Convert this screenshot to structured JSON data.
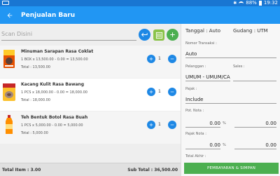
{
  "status_bar": {
    "battery": "88%",
    "time": "19:32"
  },
  "app_bar": {
    "title": "Penjualan Baru"
  },
  "scan": {
    "placeholder": "Scan Disini"
  },
  "items": [
    {
      "name": "Minuman Sarapan Rasa Coklat",
      "detail": "1 BOX x 13,500.00 - 0.00 = 13,500.00",
      "total": "Total : 13,500.00",
      "qty": "1"
    },
    {
      "name": "Kacang Kulit Rasa Bawang",
      "detail": "1 PCS x 18,000.00 - 0.00 = 18,000.00",
      "total": "Total : 18,000.00",
      "qty": "1"
    },
    {
      "name": "Teh Bentuk Botol Rasa Buah",
      "detail": "1 PCS x 5,000.00 - 0.00 = 5,000.00",
      "total": "Total : 5,000.00",
      "qty": "1"
    }
  ],
  "footer": {
    "total_item": "Total Item : 3.00",
    "sub_total": "Sub Total : 36,500.00"
  },
  "right_pane": {
    "tanggal": "Tanggal : Auto",
    "gudang": "Gudang : UTM",
    "nomor_transaksi_label": "Nomor Transaksi :",
    "nomor_transaksi_value": "Auto",
    "pelanggan_label": "Pelanggan :",
    "pelanggan_value": "UMUM - UMUM/CA",
    "sales_label": "Sales :",
    "pajak_label": "Pajak :",
    "pajak_value": "Include",
    "pot_nota_label": "Pot. Nota :",
    "pot_nota_percent": "0.00",
    "pot_nota_amount": "0.00",
    "pajak_nota_label": "Pajak Nota :",
    "pajak_nota_percent": "0.00",
    "pajak_nota_amount": "0.00",
    "percent_sign": "%",
    "total_akhir_label": "Total Akhir :",
    "pay_button_label": "PEMBAYARAN & SIMPAN"
  },
  "colors": {
    "app_bar": "#2196f3",
    "status_bar": "#1976d2",
    "accent_blue": "#1e88e5",
    "accent_green": "#4caf50"
  }
}
